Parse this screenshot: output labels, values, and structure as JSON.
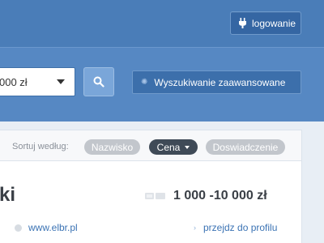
{
  "header": {
    "login_label": "logowanie",
    "login_icon": "plug-icon"
  },
  "search": {
    "price_select_value": "000 zł",
    "search_icon": "search-icon",
    "advanced_label": "Wyszukiwanie zaawansowane",
    "advanced_icon": "gear-icon"
  },
  "sort": {
    "label": "Sortuj według:",
    "options": [
      {
        "label": "Nazwisko",
        "active": false
      },
      {
        "label": "Cena",
        "active": true
      },
      {
        "label": "Doswiadczenie",
        "active": false
      }
    ]
  },
  "result": {
    "name": "ki",
    "price": "1 000 -10 000 zł",
    "website": "www.elbr.pl",
    "profile_arrow": "›",
    "profile_link": "przejdz do profilu"
  },
  "colors": {
    "header_bg": "#4a7db8",
    "search_bg": "#5688c3",
    "accent_button": "#7aa6d9",
    "active_pill": "#3f4a57",
    "inactive_pill": "#c2c6cc",
    "link": "#3b73b4"
  }
}
